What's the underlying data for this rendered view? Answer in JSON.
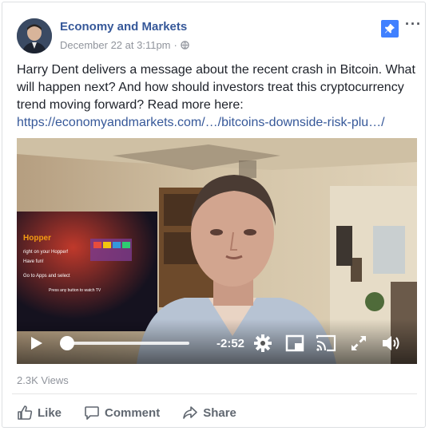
{
  "post": {
    "page_name": "Economy and Markets",
    "timestamp": "December 22 at 3:11pm",
    "separator": "·",
    "audience_icon": "globe-icon",
    "pin_icon": "pin-icon",
    "more_label": "···",
    "text": "Harry Dent delivers a message about the recent crash in Bitcoin. What will happen next? And how should investors treat this cryptocurrency trend moving forward? Read more here:",
    "link": "https://economyandmarkets.com/…/bitcoins-downside-risk-plu…/"
  },
  "video": {
    "tv_screen": {
      "brand": "Hopper",
      "line1": "right on your Hopper!",
      "line2": "Have fun!",
      "line3": "Go to Apps and select",
      "line4": "Press any button to watch TV"
    },
    "remaining_time": "-2:52",
    "progress": 0.03,
    "icons": [
      "play-icon",
      "settings-icon",
      "pip-icon",
      "cast-icon",
      "fullscreen-icon",
      "volume-icon"
    ]
  },
  "stats": {
    "views": "2.3K Views"
  },
  "actions": {
    "like": "Like",
    "comment": "Comment",
    "share": "Share"
  },
  "colors": {
    "link": "#365899",
    "pin": "#4080ff",
    "muted": "#90949c"
  }
}
